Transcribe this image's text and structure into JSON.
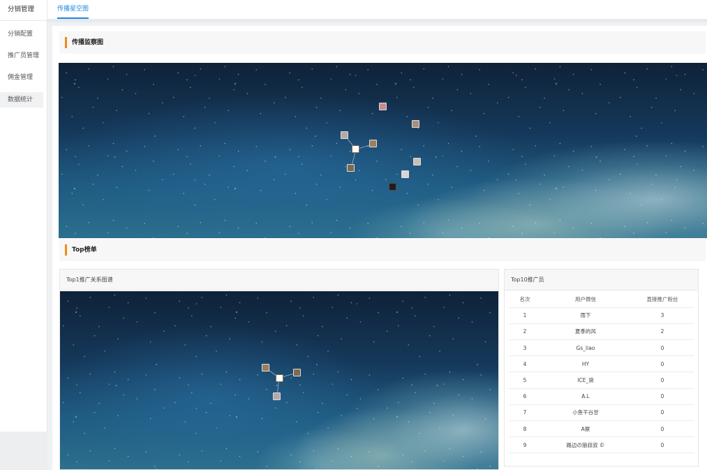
{
  "sidebar": {
    "title": "分销管理",
    "items": [
      {
        "label": "分销配置",
        "active": false
      },
      {
        "label": "推广员管理",
        "active": false
      },
      {
        "label": "佣金管理",
        "active": false
      },
      {
        "label": "数据统计",
        "active": true
      }
    ]
  },
  "tabs": [
    {
      "label": "传播星空图",
      "active": true
    }
  ],
  "sections": {
    "monitor_title": "传播监察图",
    "top_title": "Top榜单"
  },
  "relation_card": {
    "title": "Top1推广关系图谱"
  },
  "top10_card": {
    "title": "Top10推广员",
    "columns": [
      "名次",
      "用户微信",
      "直接推广粉丝"
    ],
    "rows": [
      [
        "1",
        "雨下",
        "3"
      ],
      [
        "2",
        "夏季的风",
        "2"
      ],
      [
        "3",
        "Gs_liao",
        "0"
      ],
      [
        "4",
        "HY",
        "0"
      ],
      [
        "5",
        "ICE_袋",
        "0"
      ],
      [
        "6",
        "A.L",
        "0"
      ],
      [
        "7",
        "小鱼干谷甘",
        "0"
      ],
      [
        "8",
        "A察",
        "0"
      ],
      [
        "9",
        "路边の狼叔叔 ©",
        "0"
      ]
    ]
  },
  "colors": {
    "accent": "#1e88e5",
    "section_marker": "#f08a1c"
  },
  "icons": {
    "avatar_nodes": "user-avatar-icon"
  }
}
